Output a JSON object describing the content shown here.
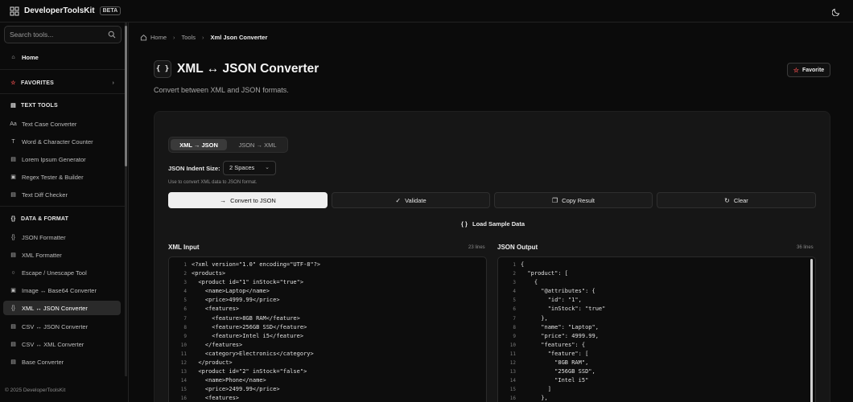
{
  "header": {
    "brand": "DeveloperToolsKit",
    "badge": "BETA"
  },
  "sidebar": {
    "search_placeholder": "Search tools...",
    "home": "Home",
    "favorites": "FAVORITES",
    "sections": [
      {
        "title": "TEXT TOOLS",
        "items": [
          "Text Case Converter",
          "Word & Character Counter",
          "Lorem Ipsum Generator",
          "Regex Tester & Builder",
          "Text Diff Checker"
        ]
      },
      {
        "title": "DATA & FORMAT",
        "items": [
          "JSON Formatter",
          "XML Formatter",
          "Escape / Unescape Tool",
          "Image ↔ Base64 Converter",
          "XML ↔ JSON Converter",
          "CSV ↔ JSON Converter",
          "CSV ↔ XML Converter",
          "Base Converter"
        ]
      }
    ],
    "copyright": "© 2025 DeveloperToolsKit"
  },
  "breadcrumb": {
    "home": "Home",
    "tools": "Tools",
    "current": "Xml Json Converter"
  },
  "page": {
    "icon_text": "{ }",
    "title": "XML ↔ JSON Converter",
    "description": "Convert between XML and JSON formats.",
    "favorite": "Favorite"
  },
  "converter": {
    "modes": [
      "XML → JSON",
      "JSON → XML"
    ],
    "active_mode": "XML → JSON",
    "indent_label": "JSON Indent Size:",
    "indent_value": "2 Spaces",
    "hint": "Use to convert XML data to JSON format.",
    "actions": {
      "convert": "Convert to JSON",
      "validate": "Validate",
      "copy": "Copy Result",
      "clear": "Clear"
    },
    "sample": "Load Sample Data",
    "input": {
      "label": "XML Input",
      "count": "23 lines",
      "lines": [
        "<?xml version=\"1.0\" encoding=\"UTF-8\"?>",
        "<products>",
        "  <product id=\"1\" inStock=\"true\">",
        "    <name>Laptop</name>",
        "    <price>4999.99</price>",
        "    <features>",
        "      <feature>8GB RAM</feature>",
        "      <feature>256GB SSD</feature>",
        "      <feature>Intel i5</feature>",
        "    </features>",
        "    <category>Electronics</category>",
        "  </product>",
        "  <product id=\"2\" inStock=\"false\">",
        "    <name>Phone</name>",
        "    <price>2499.99</price>",
        "    <features>"
      ]
    },
    "output": {
      "label": "JSON Output",
      "count": "36 lines",
      "lines": [
        "{",
        "  \"product\": [",
        "    {",
        "      \"@attributes\": {",
        "        \"id\": \"1\",",
        "        \"inStock\": \"true\"",
        "      },",
        "      \"name\": \"Laptop\",",
        "      \"price\": 4999.99,",
        "      \"features\": {",
        "        \"feature\": [",
        "          \"8GB RAM\",",
        "          \"256GB SSD\",",
        "          \"Intel i5\"",
        "        ]",
        "      },"
      ]
    }
  }
}
